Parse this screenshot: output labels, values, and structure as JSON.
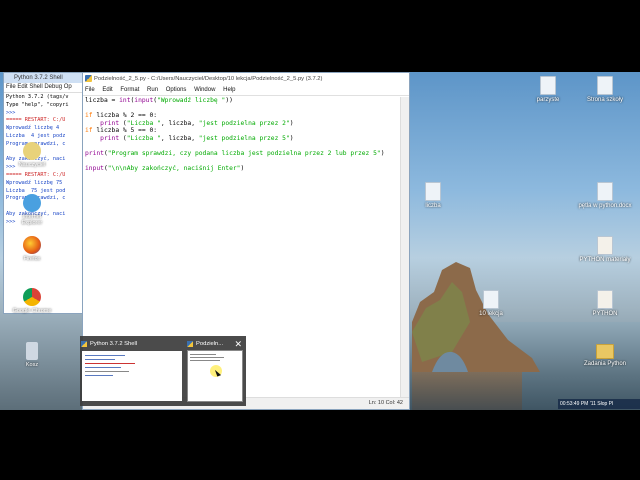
{
  "editor": {
    "title": "Podzielność_2_5.py - C:/Users/Nauczyciel/Desktop/10 lekcja/Podzielność_2_5.py (3.7.2)",
    "menu": [
      "File",
      "Edit",
      "Format",
      "Run",
      "Options",
      "Window",
      "Help"
    ],
    "code": [
      "liczba = int(input(\"Wprowadź liczbę \"))",
      "",
      "if liczba % 2 == 0:",
      "    print (\"Liczba \", liczba, \"jest podzielna przez 2\")",
      "if liczba % 5 == 0:",
      "    print (\"Liczba \", liczba, \"jest podzielna przez 5\")",
      "",
      "print(\"Program sprawdzi, czy podana liczba jest podzielna przez 2 lub przez 5\")",
      "",
      "input(\"\\n\\nAby zakończyć, naciśnij Enter\")"
    ],
    "status": "Ln: 10  Col: 42"
  },
  "shell": {
    "title": "Python 3.7.2 Shell",
    "menu": "File  Edit  Shell  Debug  Op",
    "lines": [
      "Python 3.7.2 (tags/v",
      "Type \"help\", \"copyri",
      ">>> ",
      "===== RESTART: C:/U",
      "Wprowadź liczbę 4",
      "Liczba  4 jest podz",
      "Program sprawdzi, c",
      "",
      "Aby zakończyć, naci",
      ">>> ",
      "===== RESTART: C:/U",
      "Wprowadź liczbę 75",
      "Liczba  75 jest pod",
      "Program sprawdzi, c",
      "",
      "Aby zakończyć, naci",
      ">>> "
    ]
  },
  "desktop_left": [
    {
      "label": "Nauczyciel"
    },
    {
      "label": "Internet Explorer"
    },
    {
      "label": "Firefox"
    },
    {
      "label": "Google Chrome"
    },
    {
      "label": "Kosz"
    }
  ],
  "desktop_right": [
    {
      "label": "parzyste"
    },
    {
      "label": "Strona szkoły"
    },
    {
      "label": "liczba"
    },
    {
      "label": "pętla w python.docx"
    },
    {
      "label": "PYTHON materiały"
    },
    {
      "label": "10 lekcja"
    },
    {
      "label": "PYTHON"
    },
    {
      "label": "Zadania Python"
    }
  ],
  "taskbar_preview": {
    "items": [
      {
        "title": "Python 3.7.2 Shell"
      },
      {
        "title": "Podzieln..."
      }
    ],
    "close": "✕"
  },
  "clock": "00:53:49 PM  '11  Słop  Pl",
  "icons": {
    "python": "python-file-icon",
    "close": "close-icon",
    "cursor": "mouse-pointer-icon"
  }
}
